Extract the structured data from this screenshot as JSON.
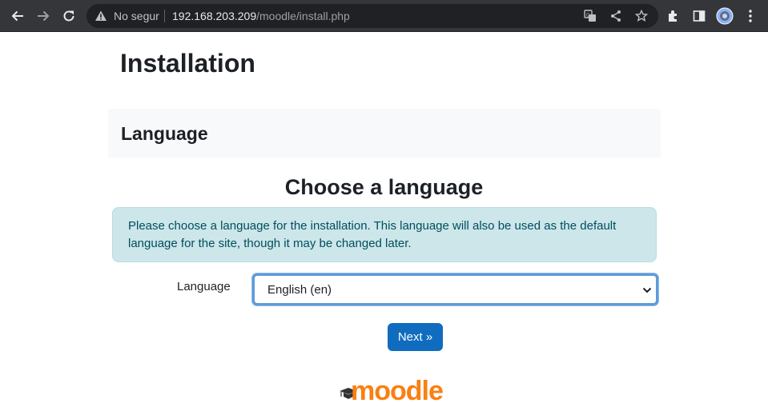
{
  "browser": {
    "security_label": "No segur",
    "url_host": "192.168.203.209",
    "url_path": "/moodle/install.php",
    "icons": [
      "back-arrow-icon",
      "forward-arrow-icon",
      "reload-icon",
      "warning-icon",
      "translate-icon",
      "share-icon",
      "star-icon",
      "extensions-icon",
      "side-panel-icon",
      "profile-avatar",
      "menu-icon"
    ]
  },
  "page": {
    "title": "Installation",
    "section_title": "Language",
    "heading": "Choose a language",
    "info_text": "Please choose a language for the installation. This language will also be used as the default language for the site, though it may be changed later.",
    "form": {
      "language_label": "Language",
      "language_selected": "English (en)"
    },
    "next_button": "Next »",
    "logo_text": "moodle"
  },
  "colors": {
    "accent": "#0f6cbf",
    "alert_bg": "#cce6ea",
    "logo_orange": "#f98012"
  }
}
